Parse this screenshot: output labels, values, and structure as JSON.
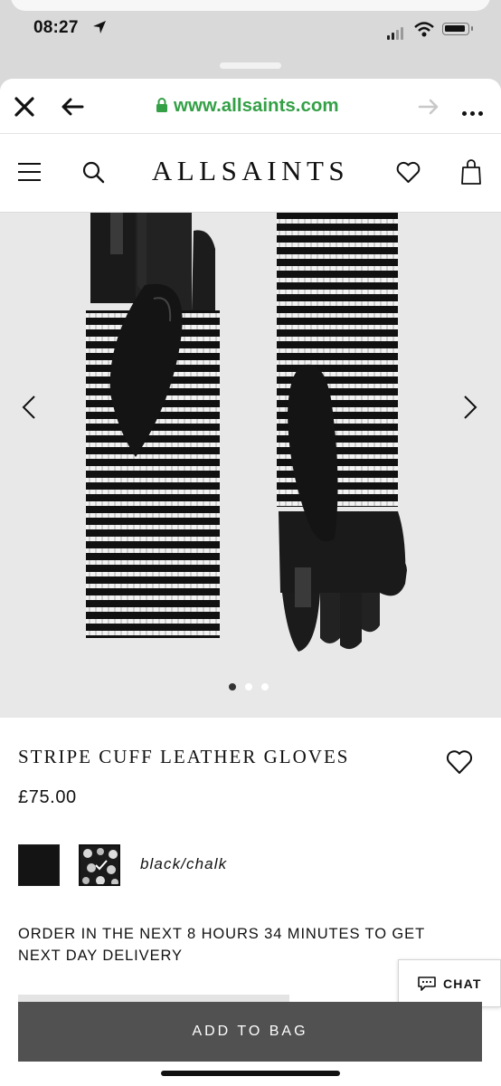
{
  "status_bar": {
    "time": "08:27"
  },
  "browser": {
    "url": "www.allsaints.com"
  },
  "site": {
    "logo": "ALLSAINTS"
  },
  "product": {
    "title": "STRIPE CUFF LEATHER GLOVES",
    "price": "£75.00",
    "colour_name": "black/chalk",
    "delivery_message": "ORDER IN THE NEXT 8 HOURS 34 MINUTES TO GET NEXT DAY DELIVERY"
  },
  "gallery": {
    "current": 1,
    "total": 3
  },
  "chat": {
    "label": "CHAT"
  },
  "cta": {
    "add_to_bag": "ADD TO BAG"
  },
  "colors": {
    "url_green": "#34a046",
    "button_grey": "#515151",
    "gallery_bg": "#e8e8e8"
  },
  "icons": [
    "close-icon",
    "back-arrow-icon",
    "lock-icon",
    "forward-arrow-icon",
    "more-icon",
    "menu-icon",
    "search-icon",
    "heart-icon",
    "bag-icon",
    "chevron-left-icon",
    "chevron-right-icon",
    "check-icon",
    "chat-icon"
  ]
}
